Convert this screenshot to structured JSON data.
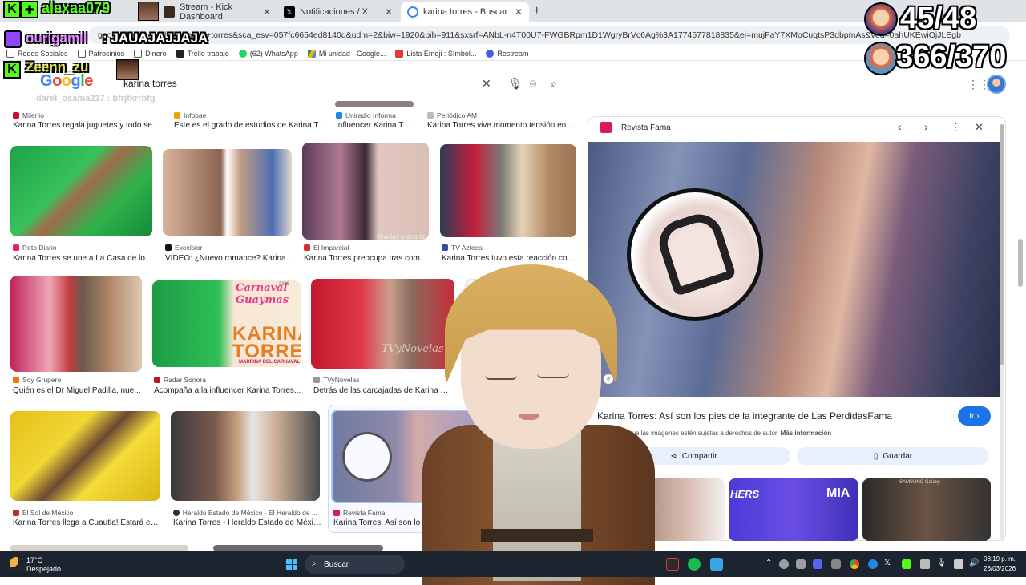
{
  "browser": {
    "tabs": [
      {
        "label": "Stream - Kick Dashboard",
        "favicon_color": "#53fc18"
      },
      {
        "label": "Notificaciones / X",
        "favicon_color": "#000000"
      },
      {
        "label": "karina torres - Buscar con Google",
        "favicon_color": "#4285f4"
      }
    ],
    "address": "google.com/search?q=karina+torres&sca_esv=057fc6654ed8140d&udm=2&biw=1920&bih=911&sxsrf=ANbL-n4T00U7-FWGBRpm1D1WgryBrVc6Ag%3A1774577818835&ei=mujFaY7XMoCuqtsP3dbpmAs&ved=0ahUKEwiOjJLEgb",
    "bookmarks": [
      {
        "label": "Redes Sociales",
        "icon": "folder-icon"
      },
      {
        "label": "Patrocinios",
        "icon": "folder-icon"
      },
      {
        "label": "Dinero",
        "icon": "folder-icon"
      },
      {
        "label": "Trello trabajo",
        "icon": "trello-icon"
      },
      {
        "label": "(62) WhatsApp",
        "icon": "whatsapp-icon"
      },
      {
        "label": "Mi unidad - Google...",
        "icon": "drive-icon"
      },
      {
        "label": "Lista Emoji : Símbol...",
        "icon": "emoji-icon"
      },
      {
        "label": "Restream",
        "icon": "restream-icon"
      }
    ]
  },
  "google": {
    "logo": "Google",
    "query": "karina torres"
  },
  "results": {
    "row0": [
      {
        "source": "Milenio",
        "title": "Karina Torres regala juguetes y todo se ..."
      },
      {
        "source": "Infobae",
        "title": "Este es el grado de estudios de Karina T..."
      },
      {
        "source": "Uniradio Informa",
        "title": "Influencer Karina T..."
      },
      {
        "source": "Periódico AM",
        "title": "Karina Torres vive momento tensión en ..."
      }
    ],
    "row1": [
      {
        "source": "Reto Diario",
        "title": "Karina Torres se une a La Casa de lo..."
      },
      {
        "source": "Excélsior",
        "title": "VIDEO: ¿Nuevo romance? Karina..."
      },
      {
        "source": "El Imparcial",
        "title": "Karina Torres preocupa tras com..."
      },
      {
        "source": "TV Azteca",
        "title": "Karina Torres tuvo esta reacción co..."
      }
    ],
    "row2": [
      {
        "source": "Soy Grupero",
        "title": "Quién es el Dr Miguel Padilla, nue..."
      },
      {
        "source": "Radar Sonora",
        "title": "Acompaña a la influencer Karina Torres..."
      },
      {
        "source": "TVyNovelas",
        "title": "Detrás de las carcajadas de Karina To..."
      }
    ],
    "row3": [
      {
        "source": "El Sol de México",
        "title": "Karina Torres llega a Cuautla! Estará en..."
      },
      {
        "source": "Heraldo Estado de México - El Heraldo de ...",
        "title": "Karina Torres - Heraldo Estado de México"
      },
      {
        "source": "Revista Fama",
        "title": "Karina Torres: Así son lo"
      }
    ],
    "image_text": {
      "carnaval_title": "Carnaval Guaymas",
      "carnaval_year": "2025",
      "carnaval_name1": "KARINA",
      "carnaval_name2": "TORRES",
      "carnaval_sub": "MADRINA DEL CARNAVAL",
      "tvnovelas_mark": "TVyNovelas",
      "gracias_text": "Gracias a dios te"
    }
  },
  "panel": {
    "source": "Revista Fama",
    "title": "Karina Torres: Así son los pies de la integrante de Las PerdidasFama",
    "ir_label": "Ir",
    "notice": "Es posible que las imágenes estén sujetas a derechos de autor.",
    "notice_link": "Más información",
    "share_label": "Compartir",
    "save_label": "Guardar",
    "related_text1": "HERS",
    "related_text2": "MIA",
    "related_text3": "SAMSUNG Galaxy"
  },
  "taskbar": {
    "weather_temp": "17°C",
    "weather_desc": "Despejado",
    "search_label": "Buscar",
    "time": "08:19 p. m.",
    "date": "26/03/2026"
  },
  "overlay": {
    "chat1_user": "alexaa079",
    "chat2_user": "ourigamil",
    "chat2_msg": ": JAUAJAJJAJA",
    "chat3_user": "Zeenn_zu",
    "chat4_faded": "darel_osama217 : bfrjfkrrbfg",
    "counter1": "45/48",
    "counter2": "366/370"
  },
  "colors": {
    "kick_green": "#53fc18",
    "twitch_purple": "#9146ff",
    "google_blue": "#1a73e8",
    "taskbar": "#1c2430"
  }
}
